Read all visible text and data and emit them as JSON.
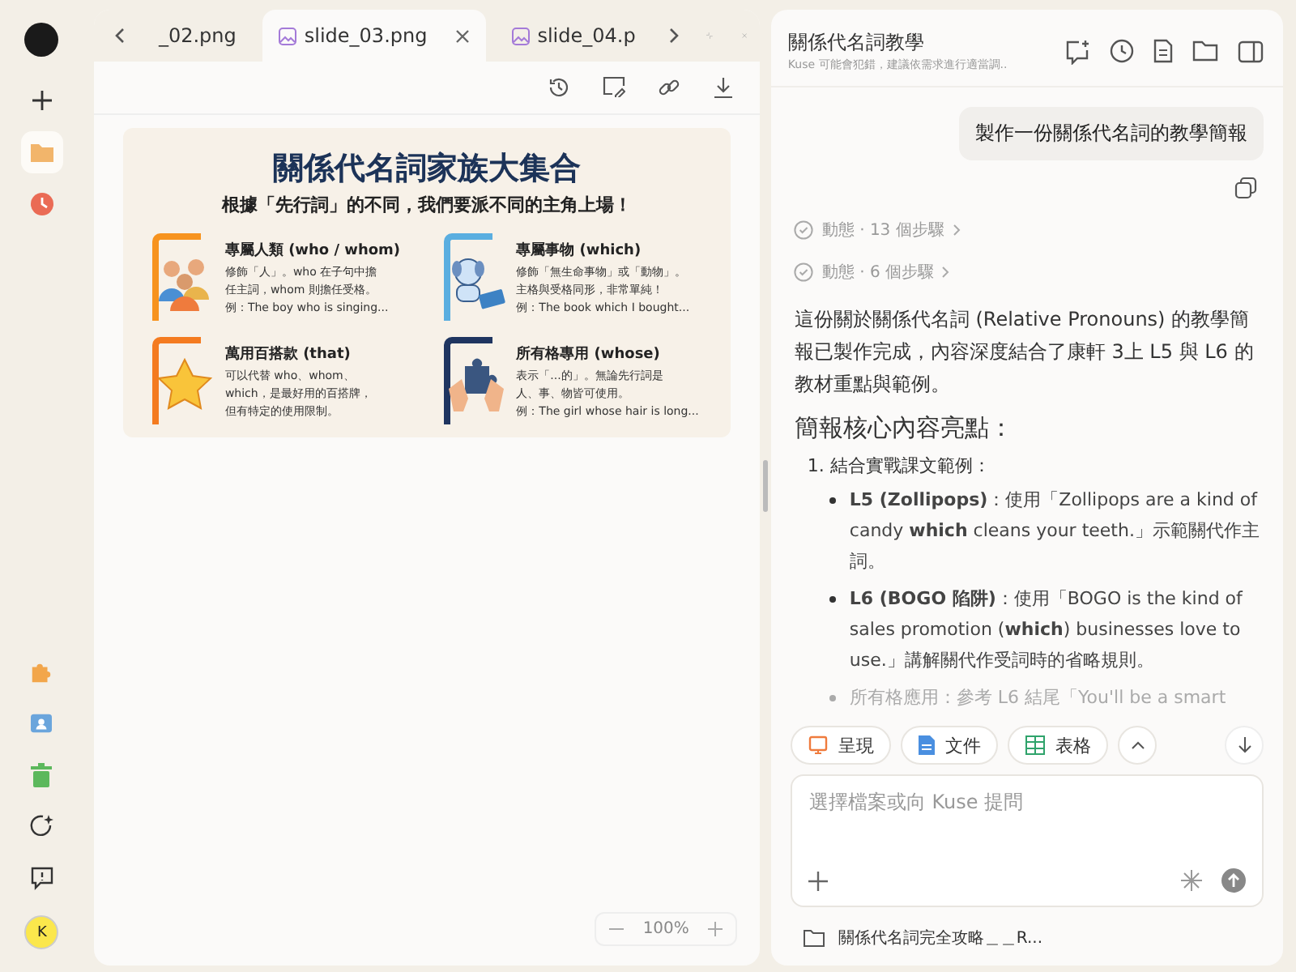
{
  "rail": {
    "top": [
      {
        "kind": "new",
        "selected": false
      },
      {
        "kind": "files",
        "selected": true
      },
      {
        "kind": "history",
        "selected": false
      }
    ],
    "bottom": [
      {
        "kind": "plugins"
      },
      {
        "kind": "contacts"
      },
      {
        "kind": "trash"
      },
      {
        "kind": "spark"
      },
      {
        "kind": "feedback"
      }
    ],
    "avatar": "K"
  },
  "tabs": [
    {
      "label": "_02.png",
      "selected": false
    },
    {
      "label": "slide_03.png",
      "selected": true
    },
    {
      "label": "slide_04.p",
      "selected": false
    }
  ],
  "zoom": "100%",
  "slide": {
    "title": "關係代名詞家族大集合",
    "subtitle": "根據「先行詞」的不同，我們要派不同的主角上場！",
    "cards": [
      {
        "kind": "people",
        "color": "#f7931e",
        "title": "專屬人類 (who / whom)",
        "lines": [
          "修飾「人」。who 在子句中擔",
          "任主詞，whom 則擔任受格。",
          "例：The boy who is singing..."
        ]
      },
      {
        "kind": "dog",
        "color": "#5aaee0",
        "title": "專屬事物 (which)",
        "lines": [
          "修飾「無生命事物」或「動物」。",
          "主格與受格同形，非常單純！",
          "例：The book which I bought..."
        ]
      },
      {
        "kind": "star",
        "color": "#f47b20",
        "title": "萬用百搭款 (that)",
        "lines": [
          "可以代替 who、whom、",
          "which，是最好用的百搭牌，",
          "但有特定的使用限制。"
        ]
      },
      {
        "kind": "puzzle",
        "color": "#1f3560",
        "title": "所有格專用 (whose)",
        "lines": [
          "表示「...的」。無論先行詞是",
          "人、事、物皆可使用。",
          "例：The girl whose hair is long..."
        ]
      }
    ]
  },
  "chat": {
    "title": "關係代名詞教學",
    "subtitle": "Kuse 可能會犯錯，建議依需求進行適當調..",
    "user_message": "製作一份關係代名詞的教學簡報",
    "steps": [
      "動態 · 13 個步驟",
      "動態 · 6 個步驟"
    ],
    "intro": "這份關於關係代名詞 (Relative Pronouns) 的教學簡報已製作完成，內容深度結合了康軒 3上 L5 與 L6 的教材重點與範例。",
    "heading": "簡報核心內容亮點：",
    "list_number": "1.",
    "list_item": "結合實戰課文範例：",
    "bullets": [
      "**L5 (Zollipops)**：使用「Zollipops are a kind of candy **which** cleans your teeth.」示範關代作主詞。",
      "**L6 (BOGO 陷阱)**：使用「BOGO is the kind of sales promotion (**which**) businesses love to use.」講解關代作受詞時的省略規則。"
    ],
    "faded_line": "所有格應用：參考 L6 結尾「You'll be a smart",
    "chips": [
      {
        "kind": "slides",
        "label": "呈現"
      },
      {
        "kind": "doc",
        "label": "文件"
      },
      {
        "kind": "sheet",
        "label": "表格"
      }
    ],
    "input": {
      "placeholder": "選擇檔案或向 Kuse 提問"
    },
    "folder": "關係代名詞完全攻略＿＿R..."
  }
}
